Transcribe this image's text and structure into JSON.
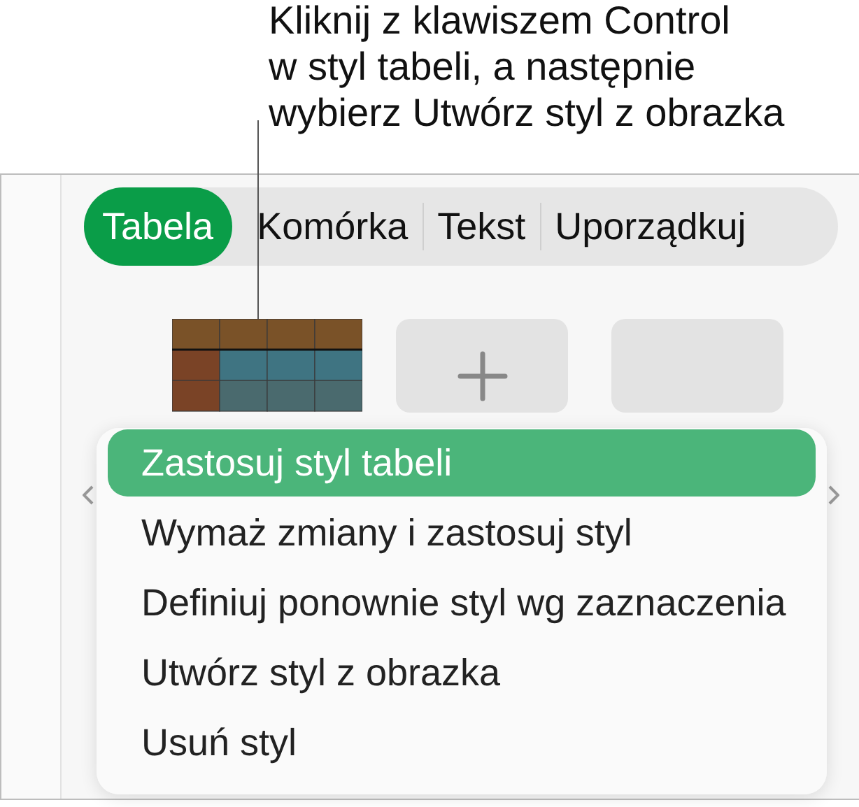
{
  "callout": {
    "lines": [
      "Kliknij z klawiszem Control",
      "w styl tabeli, a następnie",
      "wybierz Utwórz styl z obrazka"
    ]
  },
  "tabs": [
    {
      "label": "Tabela",
      "selected": true
    },
    {
      "label": "Komórka",
      "selected": false
    },
    {
      "label": "Tekst",
      "selected": false
    },
    {
      "label": "Uporządkuj",
      "selected": false
    }
  ],
  "styles": [
    {
      "kind": "table"
    },
    {
      "kind": "add"
    },
    {
      "kind": "empty"
    }
  ],
  "menu": {
    "items": [
      {
        "label": "Zastosuj styl tabeli",
        "selected": true
      },
      {
        "label": "Wymaż zmiany i zastosuj styl",
        "selected": false
      },
      {
        "label": "Definiuj ponownie styl wg zaznaczenia",
        "selected": false
      },
      {
        "label": "Utwórz styl z obrazka",
        "selected": false
      },
      {
        "label": "Usuń styl",
        "selected": false
      }
    ]
  }
}
